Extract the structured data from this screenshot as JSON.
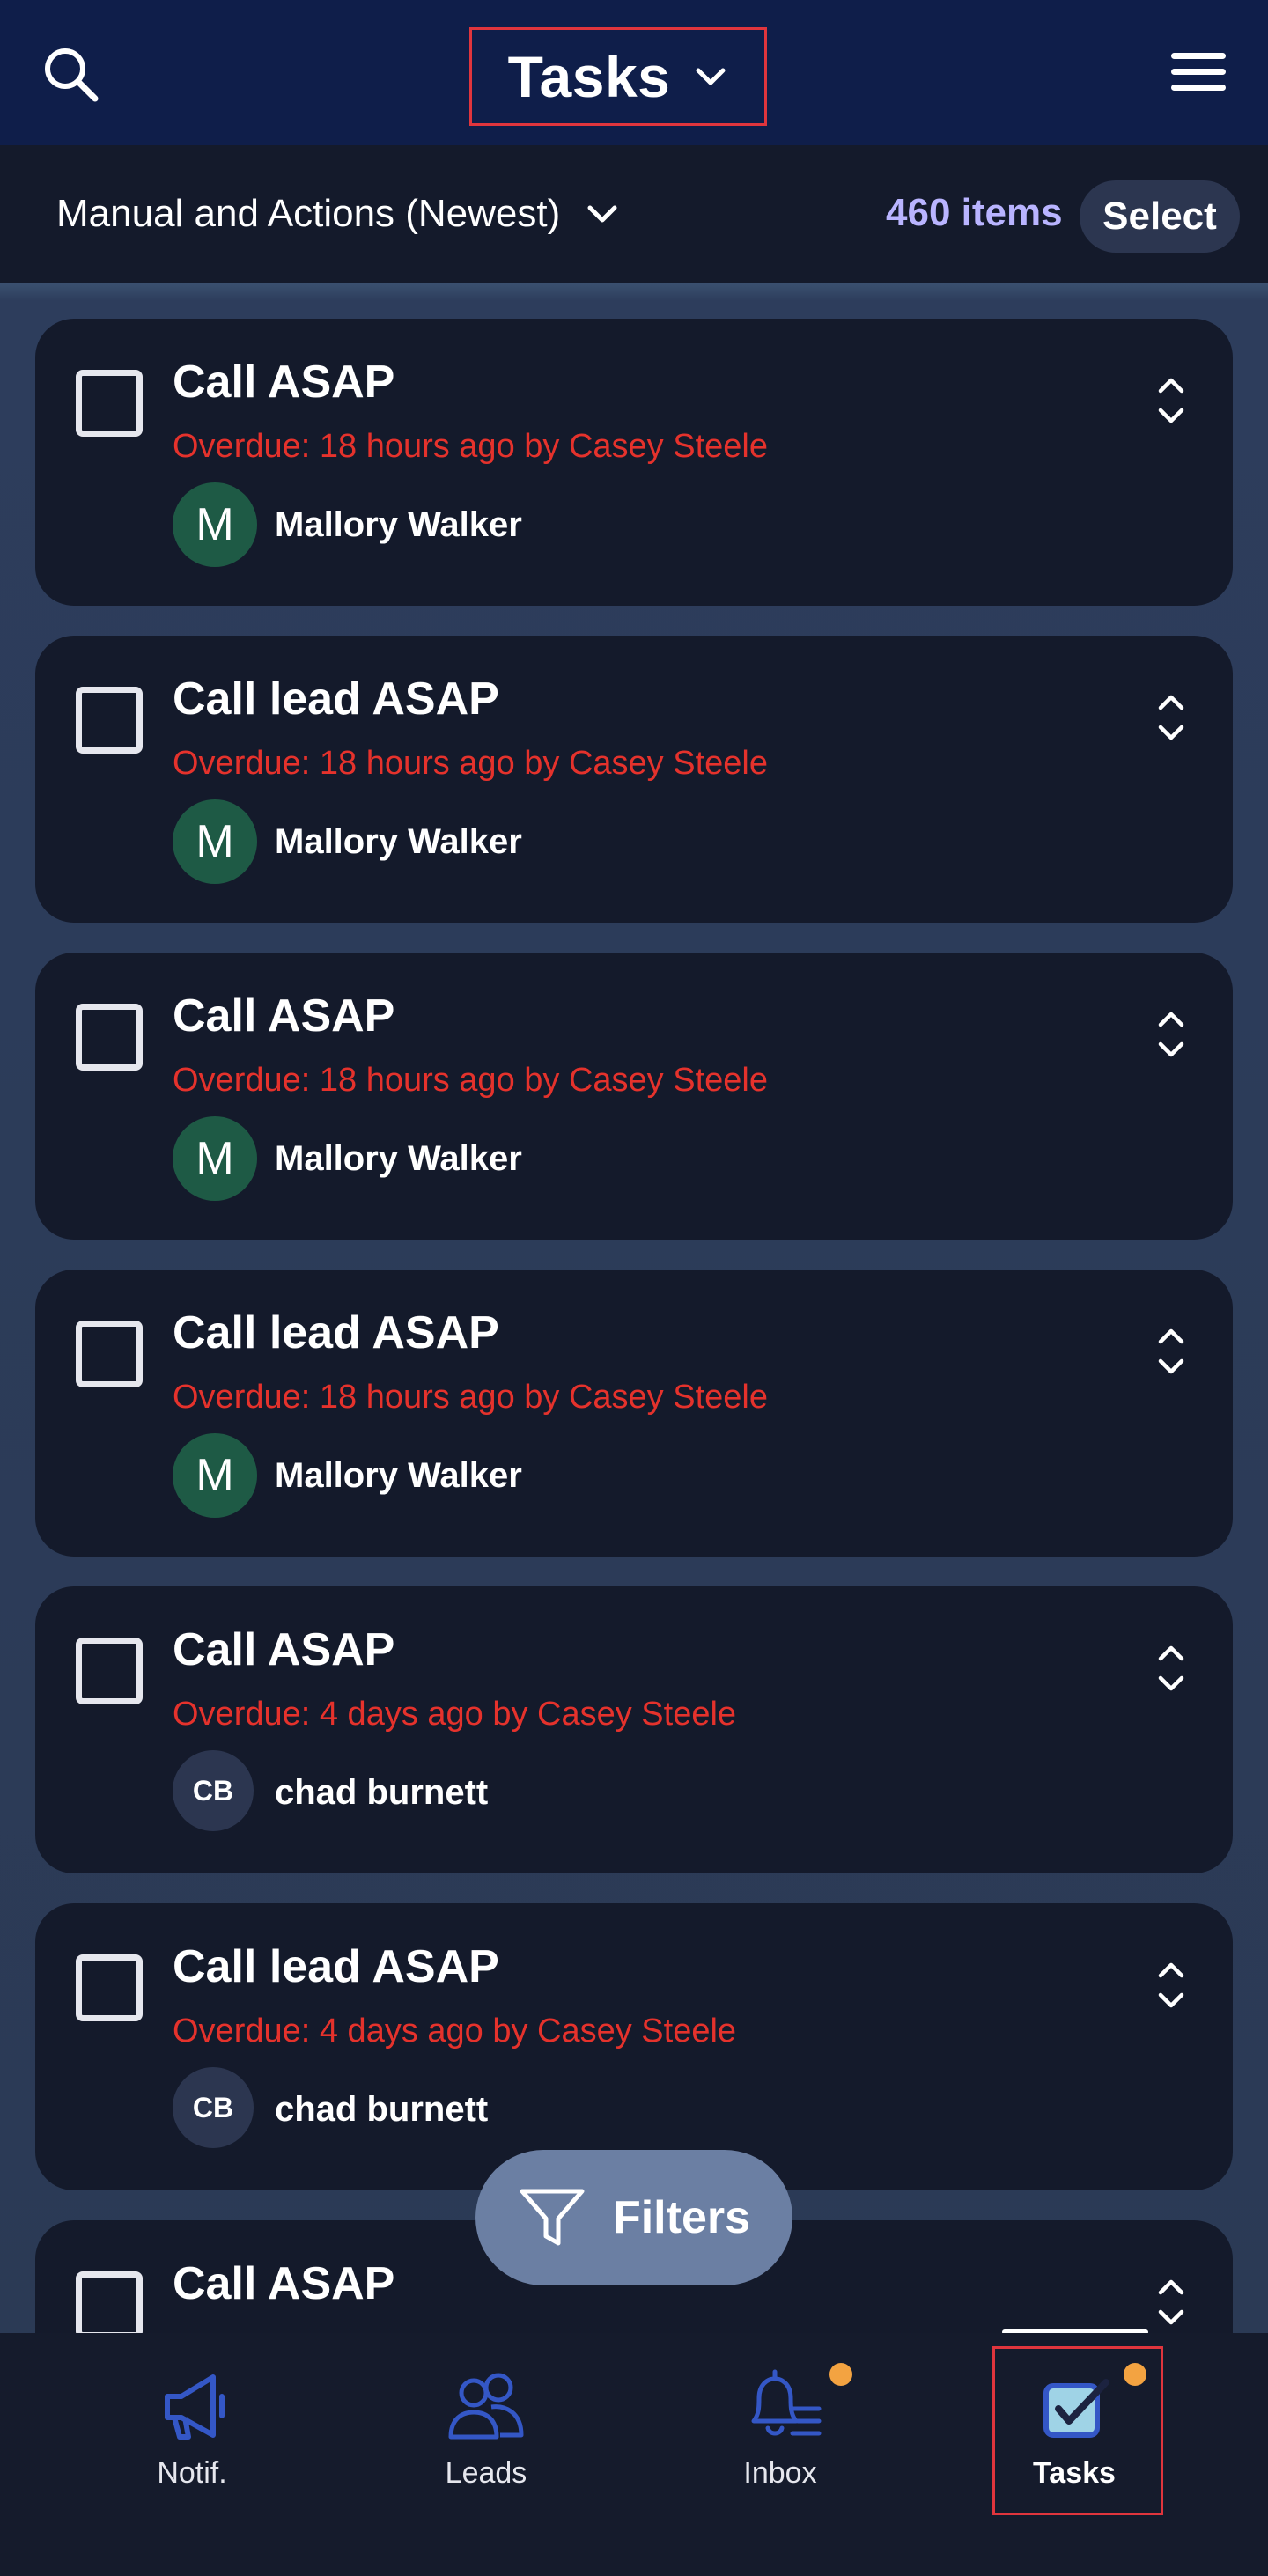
{
  "header": {
    "title": "Tasks",
    "icons": {
      "search": "search-icon",
      "title_dropdown": "chevron-down-icon",
      "menu": "hamburger-menu-icon"
    }
  },
  "sortbar": {
    "sort_label": "Manual and Actions (Newest)",
    "sort_icon": "chevron-down-icon",
    "count": "460 items",
    "select_label": "Select"
  },
  "tasks": [
    {
      "title": "Call ASAP",
      "due": "Overdue: 18 hours ago by Casey Steele",
      "avatar": "M",
      "person": "Mallory Walker"
    },
    {
      "title": "Call lead ASAP",
      "due": "Overdue: 18 hours ago by Casey Steele",
      "avatar": "M",
      "person": "Mallory Walker"
    },
    {
      "title": "Call ASAP",
      "due": "Overdue: 18 hours ago by Casey Steele",
      "avatar": "M",
      "person": "Mallory Walker"
    },
    {
      "title": "Call lead ASAP",
      "due": "Overdue: 18 hours ago by Casey Steele",
      "avatar": "M",
      "person": "Mallory Walker"
    },
    {
      "title": "Call ASAP",
      "due": "Overdue: 4 days ago by Casey Steele",
      "avatar": "CB",
      "person": "chad burnett"
    },
    {
      "title": "Call lead ASAP",
      "due": "Overdue: 4 days ago by Casey Steele",
      "avatar": "CB",
      "person": "chad burnett"
    },
    {
      "title": "Call ASAP",
      "due": "",
      "avatar": "",
      "person": ""
    }
  ],
  "filters": {
    "label": "Filters",
    "icon": "funnel-icon"
  },
  "bottom_nav": [
    {
      "label": "Notif.",
      "icon": "megaphone-icon",
      "badge": false
    },
    {
      "label": "Leads",
      "icon": "people-icon",
      "badge": false
    },
    {
      "label": "Inbox",
      "icon": "bell-list-icon",
      "badge": true
    },
    {
      "label": "Tasks",
      "icon": "checkbox-icon",
      "badge": true,
      "active": true
    }
  ],
  "colors": {
    "header_bg": "#0f1e4a",
    "card_bg": "#141a2b",
    "overdue": "#e5322c",
    "count": "#b9b4ff",
    "badge": "#f3a341",
    "avatar_green": "#1e5a45",
    "highlight": "#e0353d"
  }
}
